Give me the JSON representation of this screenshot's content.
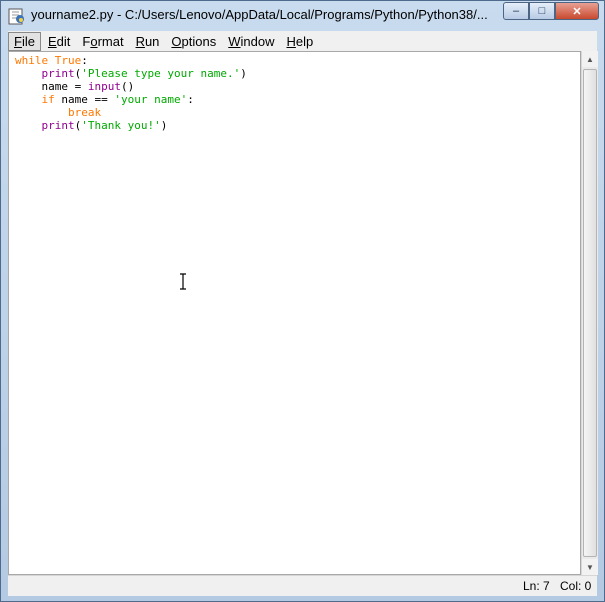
{
  "window": {
    "title": "yourname2.py - C:/Users/Lenovo/AppData/Local/Programs/Python/Python38/...",
    "icon": "python-idle-icon",
    "controls": {
      "minimize": "–",
      "maximize": "□",
      "close": "✕"
    }
  },
  "menu": {
    "file": {
      "key": "F",
      "rest": "ile"
    },
    "edit": {
      "key": "E",
      "rest": "dit"
    },
    "format": {
      "pre": "F",
      "key": "o",
      "rest": "rmat"
    },
    "run": {
      "key": "R",
      "rest": "un"
    },
    "options": {
      "key": "O",
      "rest": "ptions"
    },
    "window": {
      "key": "W",
      "rest": "indow"
    },
    "help": {
      "key": "H",
      "rest": "elp"
    }
  },
  "code": {
    "l1_kw": "while",
    "l1_true": "True",
    "l1_colon": ":",
    "l2_indent": "    ",
    "l2_fn": "print",
    "l2_open": "(",
    "l2_str": "'Please type your name.'",
    "l2_close": ")",
    "l3_text": "    name = ",
    "l3_fn": "input",
    "l3_parens": "()",
    "l4_indent": "    ",
    "l4_kw": "if",
    "l4_mid": " name == ",
    "l4_str": "'your name'",
    "l4_colon": ":",
    "l5_indent": "        ",
    "l5_kw": "break",
    "l6_indent": "    ",
    "l6_fn": "print",
    "l6_open": "(",
    "l6_str": "'Thank you!'",
    "l6_close": ")"
  },
  "status": {
    "line": "Ln: 7",
    "col": "Col: 0"
  },
  "colors": {
    "keyword": "#ff7700",
    "builtin": "#900090",
    "string": "#00aa00"
  }
}
